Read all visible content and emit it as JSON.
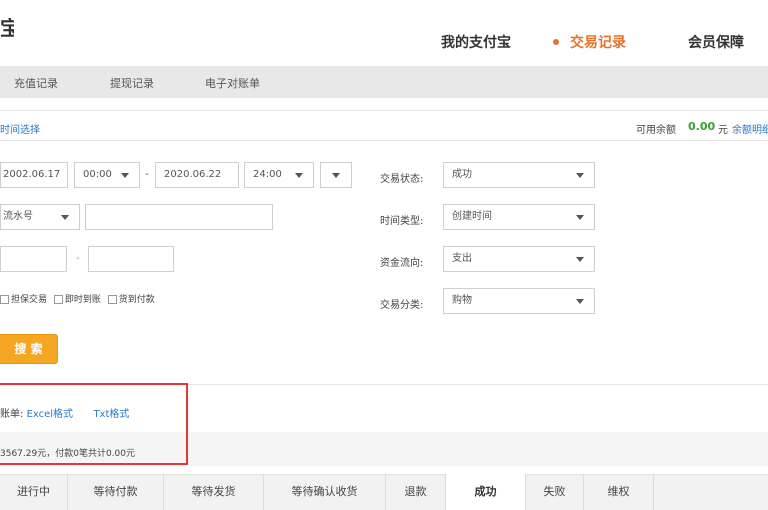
{
  "header": {
    "logo_fragment": "宝",
    "nav": [
      {
        "label": "我的支付宝"
      },
      {
        "label": "交易记录",
        "active": true
      },
      {
        "label": "会员保障"
      }
    ]
  },
  "subtabs": [
    "充值记录",
    "提现记录",
    "电子对账单"
  ],
  "panel": {
    "left_link": "时间选择",
    "balance_label": "可用余额",
    "balance_value": "0.00",
    "balance_unit": "元",
    "balance_link": "余额明细"
  },
  "filters": {
    "start_date": "2002.06.17",
    "start_time": "00:00",
    "separator": "-",
    "end_date": "2020.06.22",
    "end_time": "24:00",
    "id_type": "流水号",
    "id_value": "",
    "amount_min": "",
    "amount_max": "",
    "amount_sep": "-",
    "status_label": "交易状态:",
    "status_value": "成功",
    "time_type_label": "时间类型:",
    "time_type_value": "创建时间",
    "flow_label": "资金流向:",
    "flow_value": "支出",
    "category_label": "交易分类:",
    "category_value": "购物"
  },
  "checkboxes": [
    "担保交易",
    "即时到账",
    "货到付款"
  ],
  "search_button": "搜 索",
  "export": {
    "prefix": "账单:",
    "excel": "Excel格式",
    "txt": "Txt格式"
  },
  "summary": "3567.29元，付款0笔共计0.00元",
  "bottom_tabs": [
    {
      "label": "进行中"
    },
    {
      "label": "等待付款"
    },
    {
      "label": "等待发货"
    },
    {
      "label": "等待确认收货"
    },
    {
      "label": "退款"
    },
    {
      "label": "成功",
      "selected": true
    },
    {
      "label": "失败"
    },
    {
      "label": "维权"
    }
  ],
  "colors": {
    "accent": "#e8722c",
    "button": "#f5a623",
    "link": "#2a78c8",
    "balance": "#35a32d",
    "annotation": "#e53935"
  }
}
